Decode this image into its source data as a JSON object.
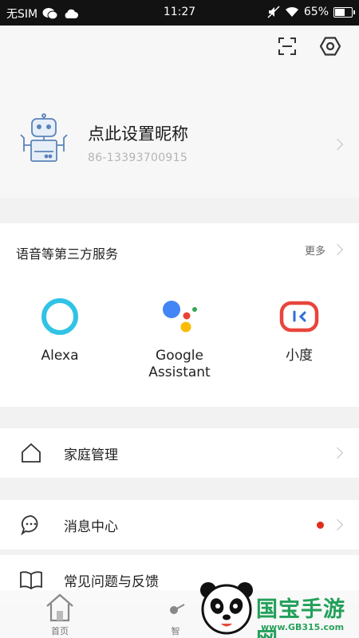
{
  "status_bar": {
    "carrier": "无SIM",
    "time": "11:27",
    "battery_percent": "65%",
    "battery_level": 0.65
  },
  "profile": {
    "nickname": "点此设置昵称",
    "phone": "86-13393700915"
  },
  "services": {
    "title": "语音等第三方服务",
    "more_label": "更多",
    "items": [
      {
        "label": "Alexa",
        "icon": "alexa-icon"
      },
      {
        "label": "Google\nAssistant",
        "icon": "google-assistant-icon"
      },
      {
        "label": "小度",
        "icon": "xiaodu-icon"
      }
    ]
  },
  "menu": {
    "home_management": "家庭管理",
    "message_center": "消息中心",
    "faq_feedback": "常见问题与反馈"
  },
  "bottom_nav": {
    "items": [
      {
        "label": "首页",
        "icon": "home-nav-icon"
      },
      {
        "label": "智",
        "icon": "smart-nav-icon"
      }
    ]
  },
  "watermark": {
    "text": "国宝手游网",
    "url": "www.GB315.com"
  },
  "colors": {
    "alexa": "#31c3e6",
    "google_blue": "#4285f4",
    "google_red": "#ea4335",
    "google_yellow": "#fbbc05",
    "google_green": "#34a853",
    "xiaodu_red": "#e8453c",
    "xiaodu_blue": "#2f6fd8",
    "notification_dot": "#e02e1b"
  }
}
